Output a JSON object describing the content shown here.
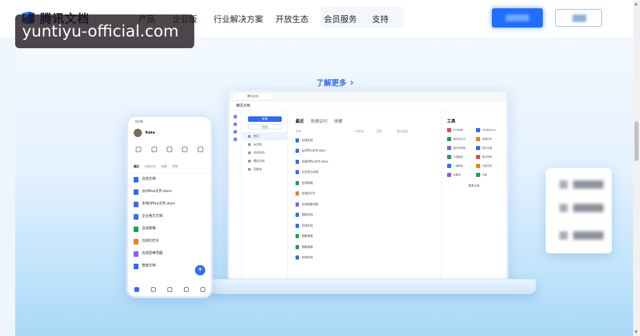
{
  "brand": {
    "name": "腾讯文档"
  },
  "nav": {
    "items": [
      "产品",
      "企业版",
      "行业解决方案",
      "开放生态",
      "会员服务",
      "支持"
    ]
  },
  "hero": {
    "learn_more": "了解更多"
  },
  "laptop": {
    "tab_label": "腾讯文档",
    "title": "腾讯文档",
    "new_button": "新建",
    "open_button": "打开",
    "sidebar": [
      "首页",
      "云文档",
      "共享空间",
      "最近文档",
      "回收站"
    ],
    "tabs": [
      "最近",
      "快速访问",
      "收藏"
    ],
    "columns": [
      "名称",
      "所有者",
      "位置",
      "最近查看"
    ],
    "rows": [
      {
        "name": "在线文档",
        "color": "#2f6bf6"
      },
      {
        "name": "云Office文件.docx",
        "color": "#2f6bf6"
      },
      {
        "name": "本地Office文件.docx",
        "color": "#2f6bf6"
      },
      {
        "name": "企业官方文档",
        "color": "#2f6bf6"
      },
      {
        "name": "在线表格",
        "color": "#1aa05a"
      },
      {
        "name": "在线幻灯片",
        "color": "#f07c1b"
      },
      {
        "name": "在线思维导图",
        "color": "#8a5cf0"
      },
      {
        "name": "智能文档",
        "color": "#2f6bf6"
      },
      {
        "name": "在线文档",
        "color": "#2f6bf6"
      },
      {
        "name": "智能表格",
        "color": "#1aa05a"
      },
      {
        "name": "智能表格",
        "color": "#1aa05a"
      },
      {
        "name": "在线文档",
        "color": "#2f6bf6"
      }
    ],
    "tools_title": "工具",
    "tools": [
      "PDF转换",
      "PDF转Word",
      "图片转文字",
      "表格识别",
      "图片转表格",
      "图片压缩",
      "文档翻译",
      "格式转换",
      "一键排版",
      "扫描文档",
      "收集表",
      "问卷"
    ],
    "more_tools": "更多工具"
  },
  "phone": {
    "time": "12:00",
    "user": "Kaka",
    "tabs": [
      "最近",
      "快速访问",
      "收藏",
      "草稿"
    ],
    "rows": [
      {
        "name": "在线文档",
        "color": "#2f6bf6"
      },
      {
        "name": "云Office文件.docx",
        "color": "#2f6bf6"
      },
      {
        "name": "本地Office文件.docx",
        "color": "#2f6bf6"
      },
      {
        "name": "企业官方文档",
        "color": "#2f6bf6"
      },
      {
        "name": "在线表格",
        "color": "#1aa05a"
      },
      {
        "name": "在线幻灯片",
        "color": "#f07c1b"
      },
      {
        "name": "在线思维导图",
        "color": "#8a5cf0"
      },
      {
        "name": "智能文档",
        "color": "#2f6bf6"
      }
    ],
    "fab": "+"
  },
  "watermark": "yuntiyu-official.com",
  "colors": {
    "accent": "#1f6fff",
    "link": "#2d6ef0"
  }
}
